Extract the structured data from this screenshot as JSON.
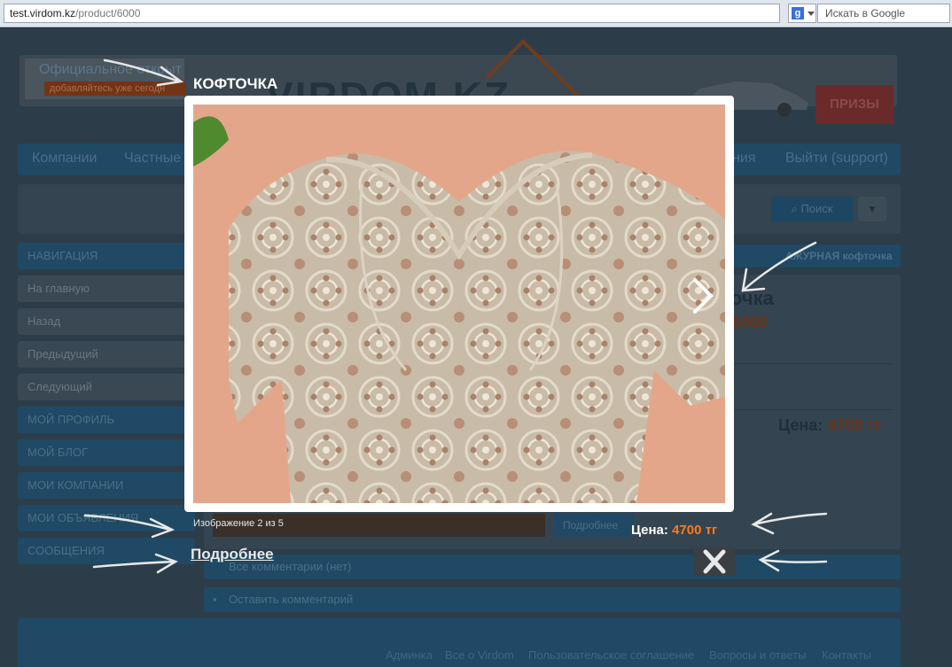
{
  "browser": {
    "url_host": "test.virdom.kz",
    "url_path": "/product/6000",
    "search_placeholder": "Искать в Google",
    "search_engine_letter": "g"
  },
  "site": {
    "promo_title": "Официальное открыт",
    "promo_sub": "добавляйтесь уже сегодн",
    "logo": "VIRDOM.KZ",
    "prize_label": "ПРИЗЫ",
    "nav": [
      "Компании",
      "Частные",
      "ния",
      "Выйти (support)"
    ],
    "search_button": "Поиск",
    "sidebar": [
      {
        "label": "НАВИГАЦИЯ",
        "style": "dark"
      },
      {
        "label": "На главную",
        "style": "light"
      },
      {
        "label": "Назад",
        "style": "light"
      },
      {
        "label": "Предыдущий",
        "style": "light"
      },
      {
        "label": "Следующий",
        "style": "light"
      },
      {
        "label": "МОЙ ПРОФИЛЬ",
        "style": "dark"
      },
      {
        "label": "МОЙ БЛОГ",
        "style": "dark"
      },
      {
        "label": "МОИ КОМПАНИИ",
        "style": "dark"
      },
      {
        "label": "МОИ ОБЪЯВЛЕНИЯ",
        "style": "dark"
      },
      {
        "label": "СООБЩЕНИЯ",
        "style": "dark"
      }
    ],
    "breadcrumb": "АЖУРНАЯ кофточка",
    "product_title_fragment": "очка",
    "product_id_small": "6000",
    "price_label": "Цена:",
    "price_value": "4700 тг",
    "more_button": "Подробнее",
    "comments_all": "Все комментарии (нет)",
    "comments_leave": "Оставить комментарий",
    "footer_links": [
      "Админка",
      "Все о Virdom",
      "Пользовательское соглашение",
      "Вопросы и ответы",
      "Контакты"
    ]
  },
  "lightbox": {
    "title": "КОФТОЧКА",
    "counter": "Изображение 2 из 5",
    "more_link": "Подробнее",
    "price_label": "Цена:",
    "price_value": "4700 тг",
    "accent_color": "#ff7a1a"
  }
}
